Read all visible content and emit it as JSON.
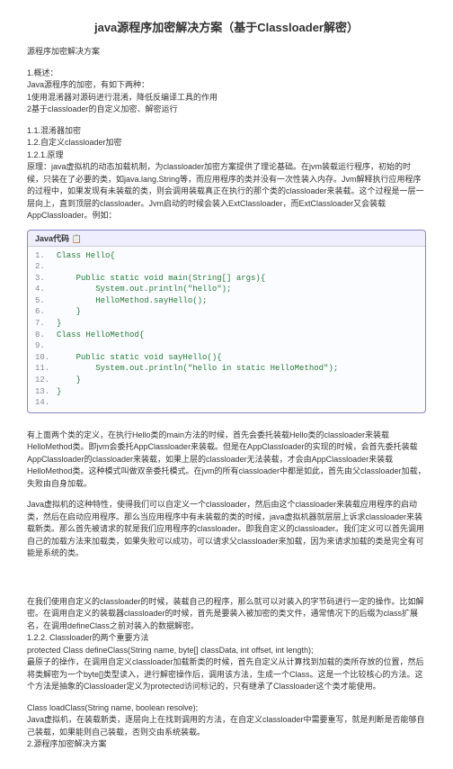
{
  "title": "java源程序加密解决方案（基于Classloader解密）",
  "intro": "源程序加密解决方案",
  "s1": "1.概述：",
  "s1_1": "Java源程序的加密，有如下两种：",
  "s1_2": "1使用混淆器对源码进行混淆，降低反编译工具的作用",
  "s1_3": "2基于classloader的自定义加密、解密运行",
  "s2": "1.1.混淆器加密",
  "s3": "1.2.自定义classloader加密",
  "s4": "1.2.1.原理",
  "p1": "原理：java虚拟机的动态加载机制，为classloader加密方案提供了理论基础。在jvm装载运行程序，初始的时候，只装在了必要的类，如java.lang.String等，而应用程序的类并没有一次性装入内存。Jvm解释执行应用程序的过程中，如果发现有未装载的类，则会调用装载真正在执行的那个类的classloader来装载。这个过程是一层一层向上，直到顶层的classloader。Jvm启动的时候会装入ExtClassloader，而ExtClassloader又会装载AppClassloader。例如：",
  "code_header": "Java代码",
  "code": [
    "Class Hello{",
    "",
    "    Public static void main(String[] args){",
    "        System.out.println(\"hello\");",
    "        HelloMethod.sayHello();",
    "    }",
    "}",
    "Class HelloMethod{",
    "",
    "    Public static void sayHello(){",
    "        System.out.println(\"hello in static HelloMethod\");",
    "    }",
    "}",
    ""
  ],
  "p2": "有上面两个类的定义，在执行Hello类的main方法的时候，首先会委托装载Hello类的classloader来装载HelloMethod类。即jvm会委托AppClassloader来装载。但是在AppClassloader的实现的时候，会首先委托装载AppClassloader的classloader来装载，如果上层的classloader无法装载，才会由AppClassloader来装载HelloMethod类。这种模式叫做双亲委托模式。在jvm的所有classloader中都是如此，首先由父classloader加载，失败由自身加载。",
  "p3": "Java虚拟机的这种特性，使得我们可以自定义一个classloader，然后由这个classloader来装载应用程序的启动类，然后在启动应用程序。那么当应用程序中有未装载的类的时候，java虚拟机器就层层上诉求classloader来装载新类。那么首先被请求的就是我们应用程序的classloader。即我自定义的classloader。我们定义可以首先调用自己的加载方法来加载类，如果失败可以成功，可以请求父classloader来加载，因为来请求加载的类是完全有可能是系统的类。",
  "p4": "在我们使用自定义的classloader的时候，装载自己的程序，那么就可以对装入的字节码进行一定的操作。比如解密。在调用自定义的装载器classloader的时候，首先是要装入被加密的类文件，通常情况下的后缀为class扩展名，在调用defineClass之前对装入的数据解密。",
  "s5": "1.2.2. Classloader的两个重要方法",
  "p5": "protected Class defineClass(String name, byte[] classData, int offset, int length);",
  "p6": "最原子的操作，在调用自定义classloader加载新类的时候，首先自定义从计算找到加载的类所存放的位置，然后将类解密为一个byte[]类型读入，进行解密操作后，调用该方法，生成一个Class。这是一个比较核心的方法。这个方法是抽象的Classloader定义为protected访问标记的，只有继承了Classloader这个类才能使用。",
  "p7": "Class loadClass(String name, boolean resolve);",
  "p8": "Java虚拟机，在装载新类，逐层向上在找到调用的方法，在自定义classloader中需要重写，就是判断是否能够自己装载，如果能则自己装载，否则交由系统装载。",
  "s6": "2.源程序加密解决方案"
}
